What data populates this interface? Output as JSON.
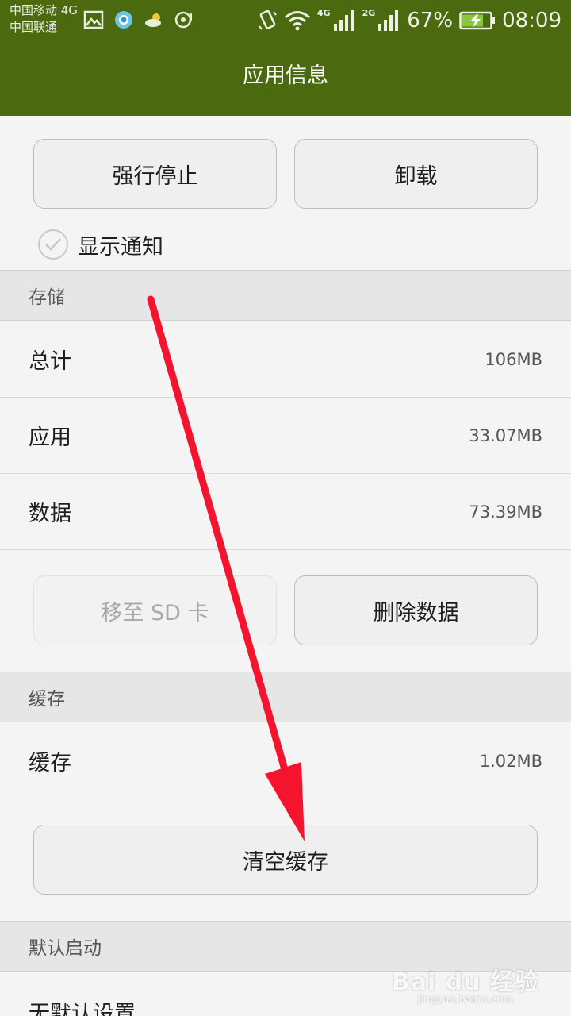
{
  "status_bar": {
    "carrier_1": "中国移动 4G",
    "carrier_2": "中国联通",
    "net_1": "4G",
    "net_2": "2G",
    "battery_percent": "67%",
    "time": "08:09",
    "icons": [
      "gallery-icon",
      "browser-icon",
      "weather-icon",
      "media-icon",
      "vibrate-icon",
      "wifi-icon",
      "signal-icon",
      "battery-charging-icon"
    ]
  },
  "header": {
    "title": "应用信息"
  },
  "actions": {
    "force_stop": "强行停止",
    "uninstall": "卸载"
  },
  "notification": {
    "label": "显示通知"
  },
  "storage": {
    "section_title": "存储",
    "rows": [
      {
        "label": "总计",
        "value": "106MB"
      },
      {
        "label": "应用",
        "value": "33.07MB"
      },
      {
        "label": "数据",
        "value": "73.39MB"
      }
    ],
    "move_to_sd": "移至 SD 卡",
    "clear_data": "删除数据"
  },
  "cache": {
    "section_title": "缓存",
    "row": {
      "label": "缓存",
      "value": "1.02MB"
    },
    "clear_cache": "清空缓存"
  },
  "default_launch": {
    "section_title": "默认启动",
    "row_label": "无默认设置"
  },
  "watermark": {
    "logo": "Bai du 经验",
    "url": "jingyan.baidu.com"
  },
  "colors": {
    "header_bg": "#4b6a10",
    "arrow": "#f5142e",
    "page_bg": "#f4f4f4"
  }
}
